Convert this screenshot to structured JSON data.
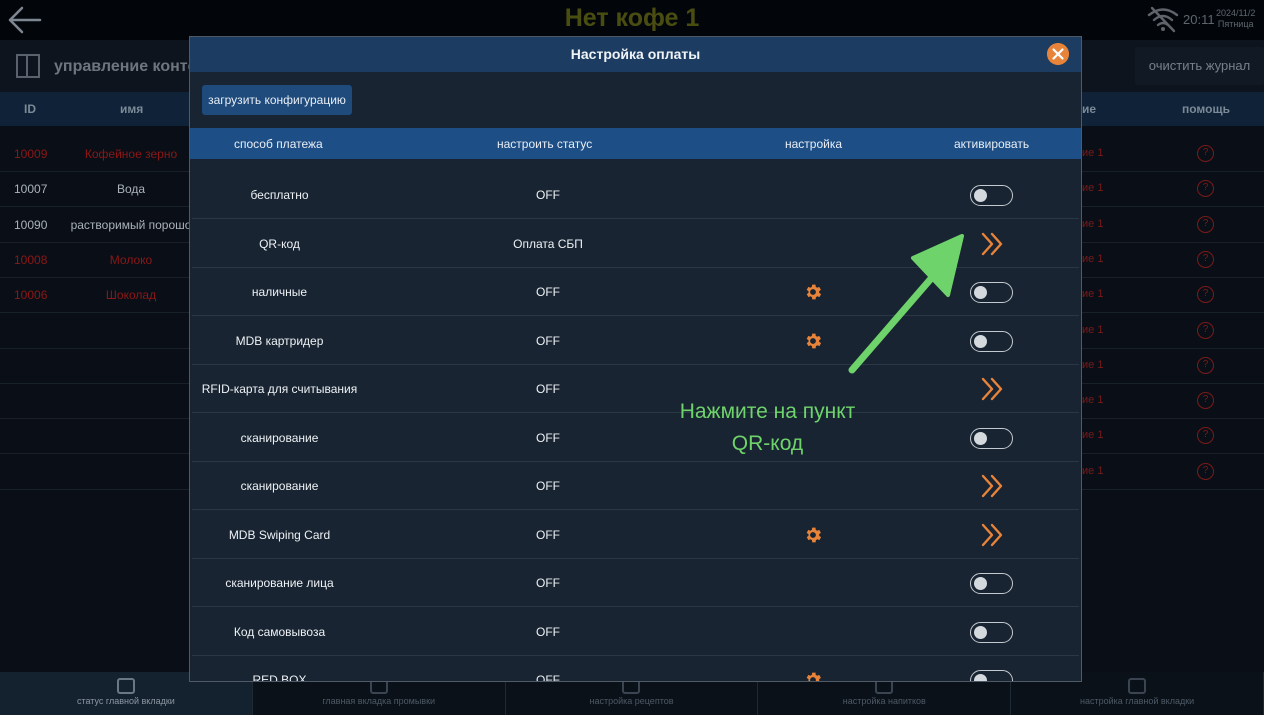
{
  "app": {
    "title": "Нет кофе 1",
    "time": "20:11",
    "date": "2024/11/2",
    "weekday": "Пятница",
    "panel_title": "управление конте",
    "clear_log_label": "очистить журнал"
  },
  "bg_table": {
    "head_id": "ID",
    "head_name": "имя",
    "head_partial": "ие",
    "head_help": "помощь",
    "rows": [
      {
        "id": "10009",
        "name": "Кофейное зерно",
        "right": "ие 1",
        "color": "#8c1717"
      },
      {
        "id": "10007",
        "name": "Вода",
        "right": "ие 1",
        "color": "#aab2ba"
      },
      {
        "id": "10090",
        "name": "растворимый порошо",
        "right": "ие 1",
        "color": "#aab2ba"
      },
      {
        "id": "10008",
        "name": "Молоко",
        "right": "ие 1",
        "color": "#8c1717"
      },
      {
        "id": "10006",
        "name": "Шоколад",
        "right": "ие 1",
        "color": "#8c1717"
      }
    ],
    "extra_right": [
      "ие 1",
      "ие 1",
      "ие 1",
      "ие 1",
      "ие 1"
    ],
    "help_glyph": "?"
  },
  "bottom_nav": [
    {
      "label": "статус главной вкладки",
      "active": true
    },
    {
      "label": "главная вкладка промывки",
      "active": false
    },
    {
      "label": "настройка рецептов",
      "active": false
    },
    {
      "label": "настройка напитков",
      "active": false
    },
    {
      "label": "настройка главной вкладки",
      "active": false
    }
  ],
  "modal": {
    "title": "Настройка оплаты",
    "load_config_label": "загрузить конфигурацию",
    "col_method": "способ платежа",
    "col_status": "настроить статус",
    "col_settings": "настройка",
    "col_activate": "активировать",
    "rows": [
      {
        "method": "бесплатно",
        "status": "OFF",
        "gear": false,
        "control": "toggle"
      },
      {
        "method": "QR-код",
        "status": "Оплата СБП",
        "gear": false,
        "control": "chevron"
      },
      {
        "method": "наличные",
        "status": "OFF",
        "gear": true,
        "control": "toggle"
      },
      {
        "method": "MDB картридер",
        "status": "OFF",
        "gear": true,
        "control": "toggle"
      },
      {
        "method": "RFID-карта для считывания",
        "status": "OFF",
        "gear": false,
        "control": "chevron"
      },
      {
        "method": "сканирование",
        "status": "OFF",
        "gear": false,
        "control": "toggle"
      },
      {
        "method": "сканирование",
        "status": "OFF",
        "gear": false,
        "control": "chevron"
      },
      {
        "method": "MDB Swiping Card",
        "status": "OFF",
        "gear": true,
        "control": "chevron"
      },
      {
        "method": "сканирование лица",
        "status": "OFF",
        "gear": false,
        "control": "toggle"
      },
      {
        "method": "Код самовывоза",
        "status": "OFF",
        "gear": false,
        "control": "toggle"
      },
      {
        "method": "RED BOX",
        "status": "OFF",
        "gear": true,
        "control": "toggle"
      }
    ]
  },
  "annotation": {
    "line1": "Нажмите на пункт",
    "line2": "QR-код"
  },
  "colors": {
    "accent_orange": "#e8833a",
    "hint_green": "#6fd36b"
  }
}
